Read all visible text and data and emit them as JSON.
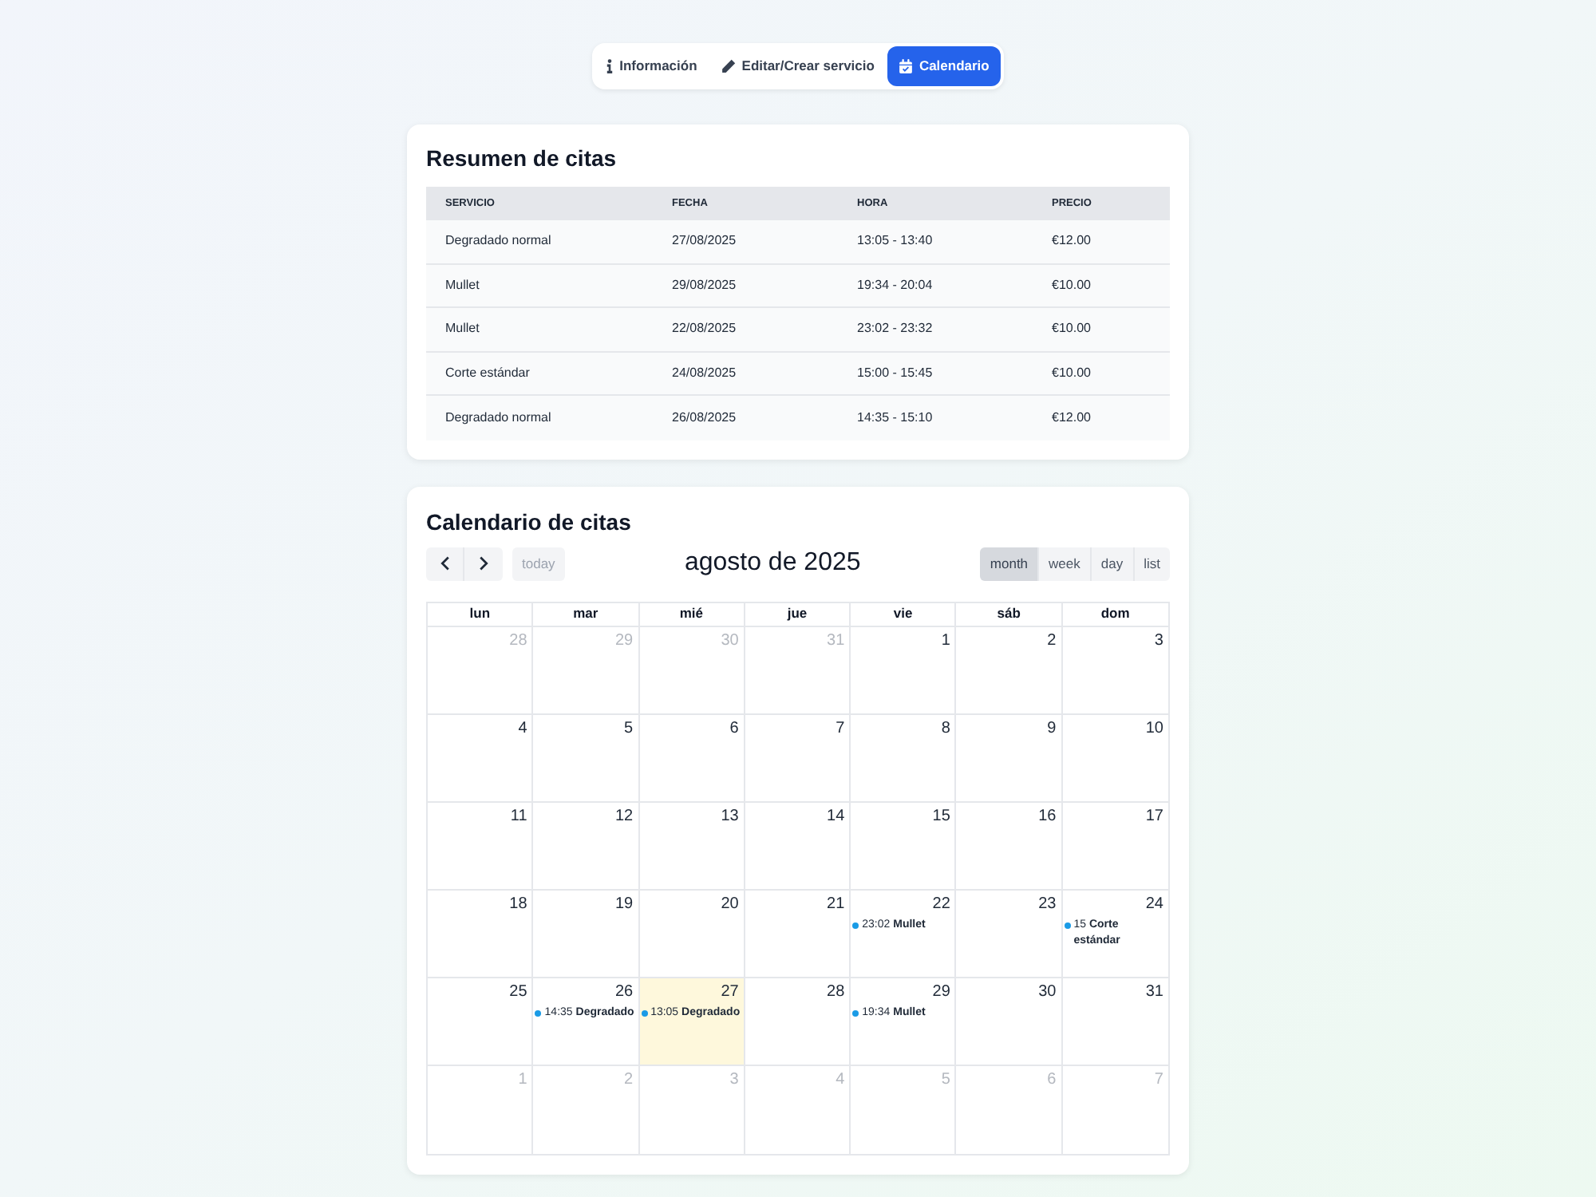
{
  "tabs": [
    {
      "label": "Información",
      "selected": false
    },
    {
      "label": "Editar/Crear servicio",
      "selected": false
    },
    {
      "label": "Calendario",
      "selected": true
    }
  ],
  "summary": {
    "title": "Resumen de citas",
    "columns": [
      "SERVICIO",
      "FECHA",
      "HORA",
      "PRECIO"
    ],
    "rows": [
      [
        "Degradado normal",
        "27/08/2025",
        "13:05 - 13:40",
        "€12.00"
      ],
      [
        "Mullet",
        "29/08/2025",
        "19:34 - 20:04",
        "€10.00"
      ],
      [
        "Mullet",
        "22/08/2025",
        "23:02 - 23:32",
        "€10.00"
      ],
      [
        "Corte estándar",
        "24/08/2025",
        "15:00 - 15:45",
        "€10.00"
      ],
      [
        "Degradado normal",
        "26/08/2025",
        "14:35 - 15:10",
        "€12.00"
      ]
    ]
  },
  "calendar": {
    "title": "Calendario de citas",
    "today_button": {
      "label": "today",
      "disabled": true
    },
    "month_title": "agosto de 2025",
    "views": [
      {
        "label": "month",
        "selected": true
      },
      {
        "label": "week",
        "selected": false
      },
      {
        "label": "day",
        "selected": false
      },
      {
        "label": "list",
        "selected": false
      }
    ],
    "weekdays": [
      "lun",
      "mar",
      "mié",
      "jue",
      "vie",
      "sáb",
      "dom"
    ],
    "weeks": [
      [
        {
          "day": "28",
          "outside": true,
          "today": false
        },
        {
          "day": "29",
          "outside": true,
          "today": false
        },
        {
          "day": "30",
          "outside": true,
          "today": false
        },
        {
          "day": "31",
          "outside": true,
          "today": false
        },
        {
          "day": "1",
          "outside": false,
          "today": false
        },
        {
          "day": "2",
          "outside": false,
          "today": false
        },
        {
          "day": "3",
          "outside": false,
          "today": false
        }
      ],
      [
        {
          "day": "4",
          "outside": false,
          "today": false
        },
        {
          "day": "5",
          "outside": false,
          "today": false
        },
        {
          "day": "6",
          "outside": false,
          "today": false
        },
        {
          "day": "7",
          "outside": false,
          "today": false
        },
        {
          "day": "8",
          "outside": false,
          "today": false
        },
        {
          "day": "9",
          "outside": false,
          "today": false
        },
        {
          "day": "10",
          "outside": false,
          "today": false
        }
      ],
      [
        {
          "day": "11",
          "outside": false,
          "today": false
        },
        {
          "day": "12",
          "outside": false,
          "today": false
        },
        {
          "day": "13",
          "outside": false,
          "today": false
        },
        {
          "day": "14",
          "outside": false,
          "today": false
        },
        {
          "day": "15",
          "outside": false,
          "today": false
        },
        {
          "day": "16",
          "outside": false,
          "today": false
        },
        {
          "day": "17",
          "outside": false,
          "today": false
        }
      ],
      [
        {
          "day": "18",
          "outside": false,
          "today": false
        },
        {
          "day": "19",
          "outside": false,
          "today": false
        },
        {
          "day": "20",
          "outside": false,
          "today": false
        },
        {
          "day": "21",
          "outside": false,
          "today": false
        },
        {
          "day": "22",
          "outside": false,
          "today": false,
          "events": [
            {
              "time": "23:02",
              "title": "Mullet"
            }
          ]
        },
        {
          "day": "23",
          "outside": false,
          "today": false
        },
        {
          "day": "24",
          "outside": false,
          "today": false,
          "events": [
            {
              "time": "15",
              "title": "Corte estándar"
            }
          ]
        }
      ],
      [
        {
          "day": "25",
          "outside": false,
          "today": false
        },
        {
          "day": "26",
          "outside": false,
          "today": false,
          "events": [
            {
              "time": "14:35",
              "title": "Degradado"
            }
          ]
        },
        {
          "day": "27",
          "outside": false,
          "today": true,
          "events": [
            {
              "time": "13:05",
              "title": "Degradado"
            }
          ]
        },
        {
          "day": "28",
          "outside": false,
          "today": false
        },
        {
          "day": "29",
          "outside": false,
          "today": false,
          "events": [
            {
              "time": "19:34",
              "title": "Mullet"
            }
          ]
        },
        {
          "day": "30",
          "outside": false,
          "today": false
        },
        {
          "day": "31",
          "outside": false,
          "today": false
        }
      ],
      [
        {
          "day": "1",
          "outside": true,
          "today": false
        },
        {
          "day": "2",
          "outside": true,
          "today": false
        },
        {
          "day": "3",
          "outside": true,
          "today": false
        },
        {
          "day": "4",
          "outside": true,
          "today": false
        },
        {
          "day": "5",
          "outside": true,
          "today": false
        },
        {
          "day": "6",
          "outside": true,
          "today": false
        },
        {
          "day": "7",
          "outside": true,
          "today": false
        }
      ]
    ]
  }
}
